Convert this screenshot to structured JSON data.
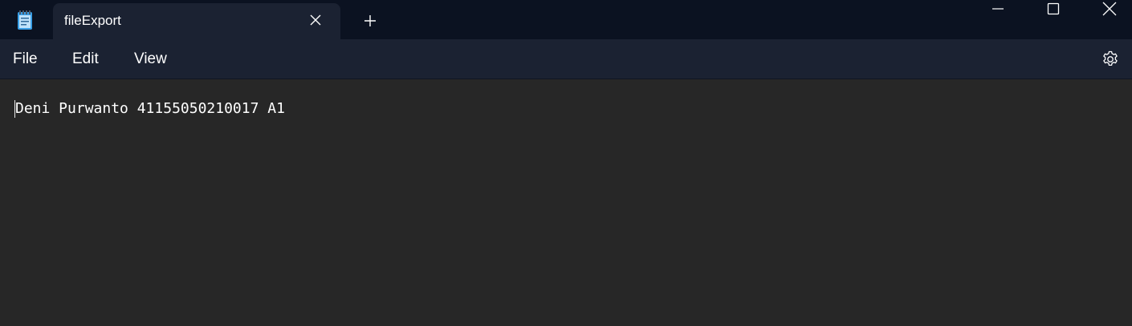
{
  "window": {
    "tab_title": "fileExport",
    "icons": {
      "app": "notepad-icon",
      "tab_close": "close-icon",
      "new_tab": "plus-icon",
      "minimize": "minimize-icon",
      "maximize": "maximize-icon",
      "close": "close-icon"
    }
  },
  "menu": {
    "items": [
      "File",
      "Edit",
      "View"
    ],
    "settings_icon": "gear-icon"
  },
  "editor": {
    "content": "Deni Purwanto 41155050210017 A1"
  },
  "colors": {
    "titlebar": "#0b1221",
    "tab_active": "#1b2232",
    "menubar": "#1b2232",
    "editor_bg": "#272727",
    "text": "#ffffff",
    "icon_accent": "#3aa0e8"
  }
}
